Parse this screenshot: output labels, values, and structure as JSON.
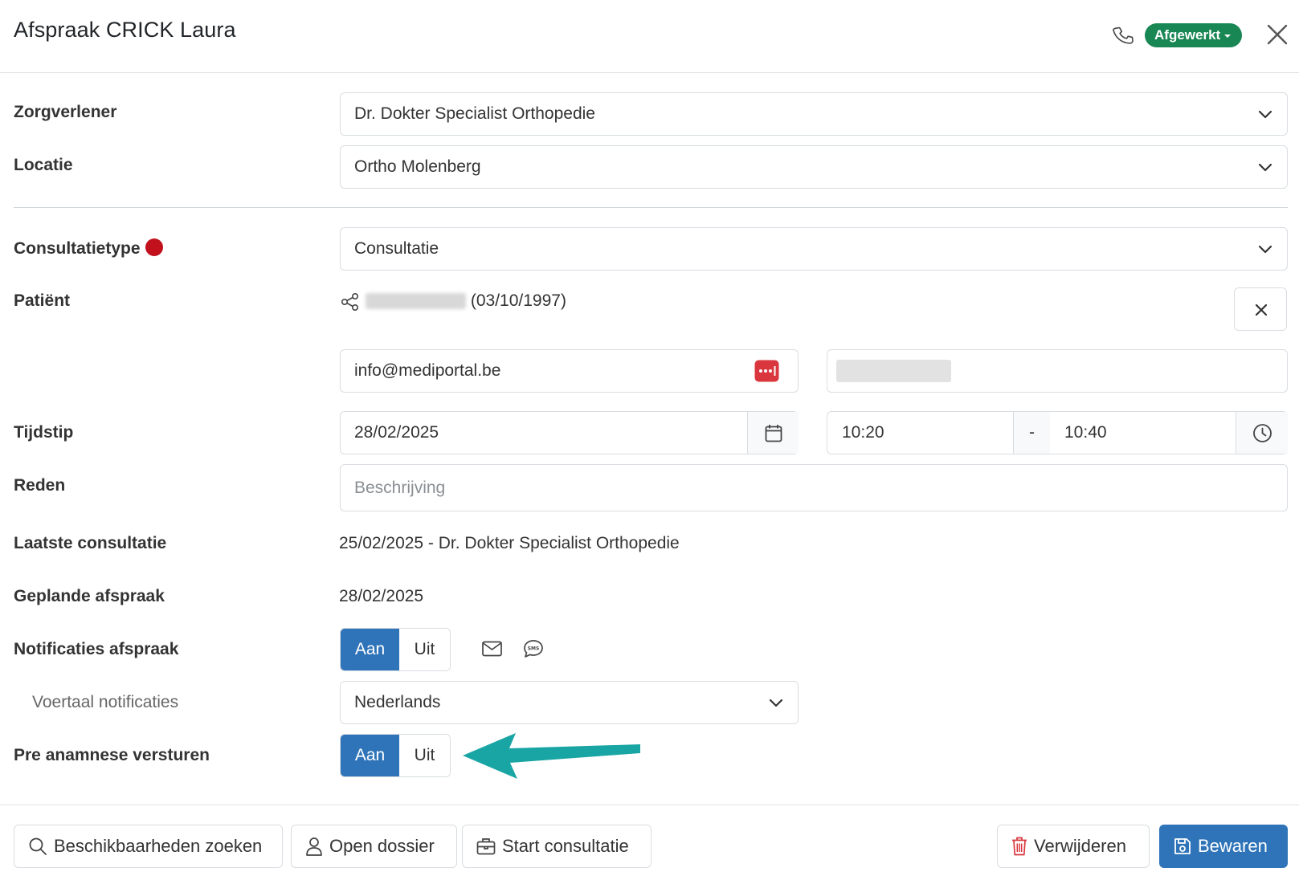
{
  "dialog": {
    "title": "Afspraak CRICK Laura",
    "status": "Afgewerkt",
    "status_color": "#198754"
  },
  "form": {
    "provider": {
      "label": "Zorgverlener",
      "value": "Dr. Dokter Specialist Orthopedie"
    },
    "location": {
      "label": "Locatie",
      "value": "Ortho Molenberg"
    },
    "consult_type": {
      "label": "Consultatietype",
      "value": "Consultatie",
      "indicator_color": "#c0111d"
    },
    "patient": {
      "label": "Patiënt",
      "name": "CRICK Laura",
      "birthdate": "(03/10/1997)"
    },
    "email": {
      "value": "info@mediportal.be"
    },
    "time": {
      "label": "Tijdstip",
      "date": "28/02/2025",
      "start": "10:20",
      "separator": "-",
      "end": "10:40"
    },
    "reason": {
      "label": "Reden",
      "placeholder": "Beschrijving"
    },
    "last_consult": {
      "label": "Laatste consultatie",
      "value": "25/02/2025 - Dr. Dokter Specialist Orthopedie"
    },
    "planned": {
      "label": "Geplande afspraak",
      "value": "28/02/2025"
    },
    "notifications": {
      "label": "Notificaties afspraak",
      "on": "Aan",
      "off": "Uit",
      "selected": "Aan"
    },
    "language": {
      "label": "Voertaal notificaties",
      "value": "Nederlands"
    },
    "pre_anamnesis": {
      "label": "Pre anamnese versturen",
      "on": "Aan",
      "off": "Uit",
      "selected": "Aan"
    }
  },
  "footer": {
    "search_availability": "Beschikbaarheden zoeken",
    "open_file": "Open dossier",
    "start_consult": "Start consultatie",
    "delete": "Verwijderen",
    "save": "Bewaren"
  },
  "colors": {
    "primary": "#2f74b8",
    "annotation_arrow": "#1aa5a5",
    "delete_icon": "#d9363e"
  }
}
